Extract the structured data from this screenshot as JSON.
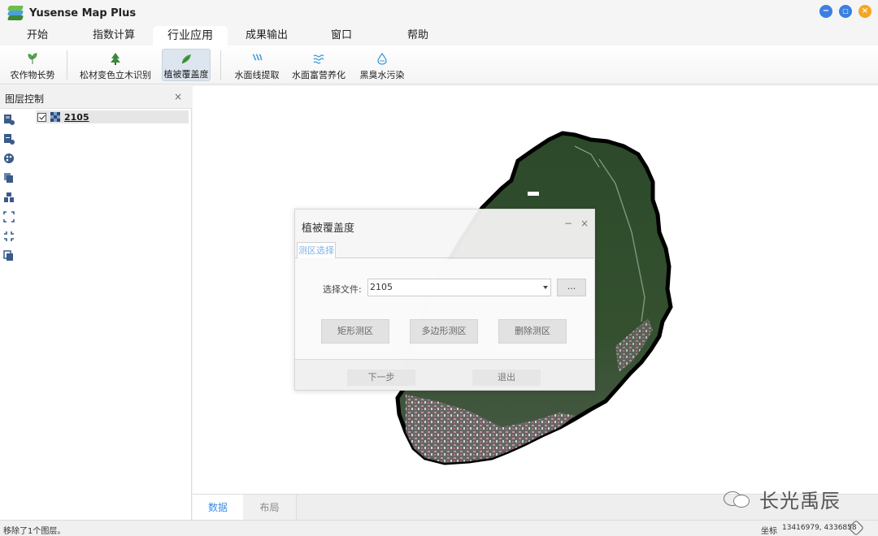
{
  "app": {
    "title": "Yusense Map Plus"
  },
  "window_controls": [
    {
      "name": "minimize",
      "glyph": "−",
      "color": "#3b7fe0"
    },
    {
      "name": "maximize",
      "glyph": "▢",
      "color": "#3b7fe0"
    },
    {
      "name": "close",
      "glyph": "×",
      "color": "#f5a623"
    }
  ],
  "menu": {
    "tabs": [
      "开始",
      "指数计算",
      "行业应用",
      "成果输出",
      "窗口",
      "帮助"
    ],
    "active": "行业应用"
  },
  "ribbon": {
    "items": [
      {
        "label": "农作物长势",
        "icon": "crop-growth-icon",
        "color": "#4aa04a"
      },
      {
        "label": "松材变色立木识别",
        "icon": "pine-tree-icon",
        "color": "#3a8a3a"
      },
      {
        "label": "植被覆盖度",
        "icon": "vegetation-cover-icon",
        "color": "#3a9a3a",
        "active": true
      },
      {
        "label": "水面线提取",
        "icon": "water-line-icon",
        "color": "#3a9ad9"
      },
      {
        "label": "水面富营养化",
        "icon": "eutrophication-icon",
        "color": "#3a9ad9"
      },
      {
        "label": "黑臭水污染",
        "icon": "black-water-icon",
        "color": "#3a9ad9"
      }
    ]
  },
  "layer_panel": {
    "title": "图层控制",
    "close_glyph": "×",
    "layers": [
      {
        "name": "2105",
        "checked": true
      }
    ],
    "tools": [
      "add-raster-icon",
      "add-vector-icon",
      "palette-icon",
      "copy-layer-icon",
      "layer-stack-icon",
      "zoom-extent-icon",
      "zoom-fit-icon",
      "duplicate-icon"
    ]
  },
  "bottom_tabs": [
    {
      "label": "数据",
      "active": true
    },
    {
      "label": "布局",
      "active": false
    }
  ],
  "watermark": {
    "text": "长光禹辰"
  },
  "status": {
    "message": "移除了1个图层。",
    "coord_label": "坐标",
    "coord_value": "13416979, 4336858"
  },
  "dialog": {
    "title": "植被覆盖度",
    "min_glyph": "−",
    "close_glyph": "×",
    "tab": "测区选择",
    "file_label": "选择文件:",
    "file_value": "2105",
    "browse_label": "...",
    "buttons": [
      "矩形测区",
      "多边形测区",
      "删除测区"
    ],
    "footer": {
      "next": "下一步",
      "exit": "退出"
    }
  },
  "colors": {
    "accent": "#3a8ee6",
    "tab_link": "#7fb0e4",
    "island_outline": "#000000",
    "forest": "#2f4a2c"
  }
}
